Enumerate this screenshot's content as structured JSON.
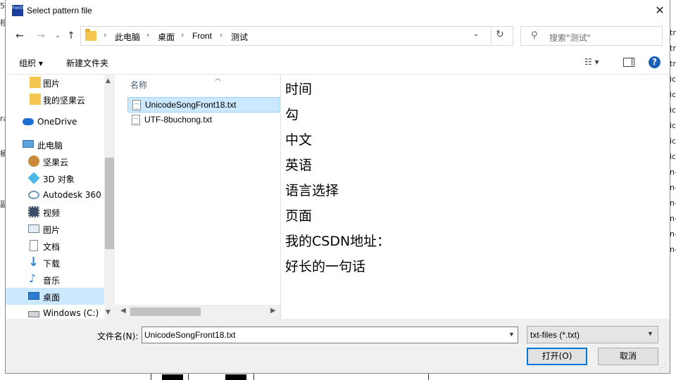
{
  "window": {
    "title": "Select pattern file",
    "app_icon_text": "FontCvt"
  },
  "nav": {
    "back_icon": "arrow-left-icon",
    "forward_icon": "arrow-right-icon",
    "recent_icon": "chevron-down-icon",
    "up_icon": "arrow-up-icon",
    "breadcrumbs": [
      "此电脑",
      "桌面",
      "Front",
      "测试"
    ],
    "search_placeholder": "搜索\"测试\""
  },
  "toolbar": {
    "organize": "组织 ▾",
    "new_folder": "新建文件夹"
  },
  "sidebar": {
    "items": [
      {
        "label": "图片",
        "icon": "folder-icon",
        "selected": false
      },
      {
        "label": "我的坚果云",
        "icon": "folder-icon",
        "selected": false
      },
      {
        "label": "OneDrive",
        "icon": "cloud-icon",
        "selected": false
      },
      {
        "label": "此电脑",
        "icon": "computer-icon",
        "selected": false
      },
      {
        "label": "坚果云",
        "icon": "nut-icon",
        "selected": false
      },
      {
        "label": "3D 对象",
        "icon": "cube-icon",
        "selected": false
      },
      {
        "label": "Autodesk 360",
        "icon": "autodesk-icon",
        "selected": false
      },
      {
        "label": "视频",
        "icon": "video-icon",
        "selected": false
      },
      {
        "label": "图片",
        "icon": "picture-icon",
        "selected": false
      },
      {
        "label": "文档",
        "icon": "document-icon",
        "selected": false
      },
      {
        "label": "下载",
        "icon": "download-icon",
        "selected": false
      },
      {
        "label": "音乐",
        "icon": "music-icon",
        "selected": false
      },
      {
        "label": "桌面",
        "icon": "desktop-icon",
        "selected": true
      },
      {
        "label": "Windows (C:)",
        "icon": "drive-icon",
        "selected": false
      }
    ]
  },
  "filelist": {
    "column_header": "名称",
    "files": [
      {
        "name": "UnicodeSongFront18.txt",
        "selected": true
      },
      {
        "name": "UTF-8buchong.txt",
        "selected": false
      }
    ]
  },
  "preview": {
    "lines": [
      "时间",
      "勾",
      "中文",
      "英语",
      "语言选择",
      "页面",
      "我的CSDN地址：",
      "好长的一句话"
    ]
  },
  "footer": {
    "filename_label": "文件名(N):",
    "filename_value": "UnicodeSongFront18.txt",
    "filetype_value": "txt-files (*.txt)",
    "open_label": "打开(O)",
    "cancel_label": "取消"
  },
  "background": {
    "left_chars": [
      "5",
      "桓",
      "ra",
      "桶",
      "副"
    ],
    "right_chars": [
      "tr",
      "tr",
      "tr",
      "ic",
      "ic",
      "ic",
      "ic",
      "ic",
      "ic",
      "n-",
      "n-",
      "n-",
      "n-",
      "n-",
      "n-"
    ]
  }
}
